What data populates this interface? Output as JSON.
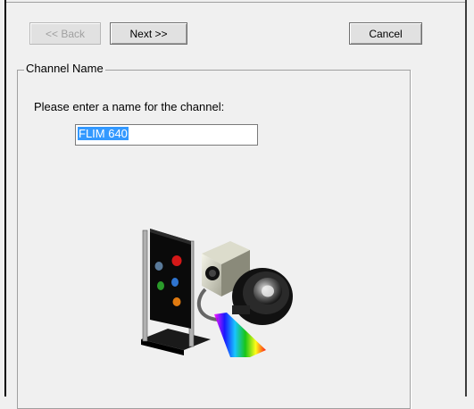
{
  "wizard": {
    "buttons": {
      "back_label": "<< Back",
      "next_label": "Next >>",
      "cancel_label": "Cancel",
      "back_enabled": false
    },
    "group_title": "Channel Name",
    "prompt": "Please enter a name for the channel:",
    "channel_name_value": "FLIM 640",
    "illustration_icon": "microscope-camera-spectrum-icon"
  },
  "colors": {
    "window_bg": "#f0f0f0",
    "selection": "#3399ff"
  }
}
